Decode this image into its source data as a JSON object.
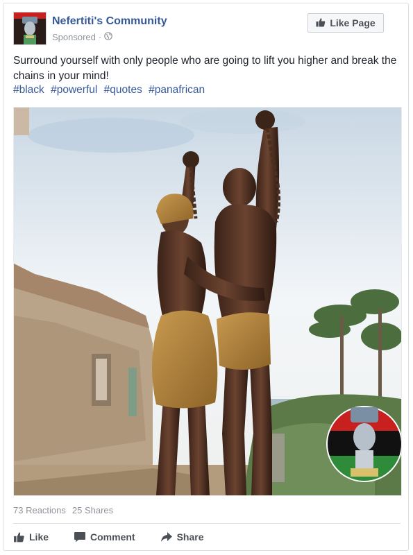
{
  "post": {
    "page_name": "Nefertiti's Community",
    "sponsored_label": "Sponsored",
    "meta_separator": "·",
    "like_page_label": "Like Page",
    "text": "Surround yourself with only people who are going to lift you higher and break the chains in your mind!",
    "hashtags": [
      "#black",
      "#powerful",
      "#quotes",
      "#panafrican"
    ],
    "icons": {
      "like_page": "thumbs-up-icon",
      "audience": "globe-icon",
      "like": "thumbs-up-icon",
      "comment": "comment-bubble-icon",
      "share": "share-arrow-icon"
    }
  },
  "stats": {
    "reactions": "73 Reactions",
    "shares": "25 Shares"
  },
  "actions": {
    "like_label": "Like",
    "comment_label": "Comment",
    "share_label": "Share"
  },
  "colors": {
    "link_blue": "#365899",
    "muted_gray": "#90949c",
    "button_text": "#4b4f56",
    "flag_red": "#c8201e",
    "flag_black": "#111111",
    "flag_green": "#2e8b3a"
  }
}
